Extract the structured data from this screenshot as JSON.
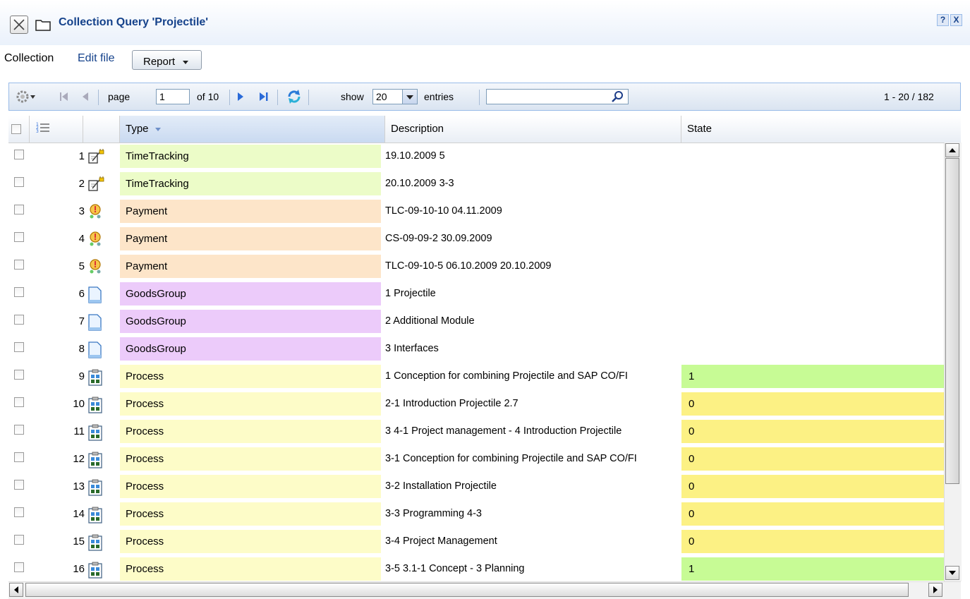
{
  "window": {
    "title": "Collection Query 'Projectile'",
    "help_label": "?",
    "close_label": "X"
  },
  "top": {
    "collection_label": "Collection",
    "edit_file_label": "Edit file",
    "report_label": "Report"
  },
  "toolbar": {
    "page_label": "page",
    "page_value": "1",
    "of_label": "of 10",
    "show_label": "show",
    "show_value": "20",
    "entries_label": "entries",
    "search_value": "",
    "range_label": "1 - 20 / 182"
  },
  "columns": {
    "type": "Type",
    "description": "Description",
    "state": "State"
  },
  "colors": {
    "TimeTracking": "#ecfcc8",
    "Payment": "#fde5c9",
    "GoodsGroup": "#eccbfa",
    "Process": "#fdfcc8",
    "state_1": "#c7fb95",
    "state_0": "#fcf184"
  },
  "rows": [
    {
      "num": "1",
      "icon": "timetracking-icon",
      "type": "TimeTracking",
      "description": "19.10.2009 5",
      "state": ""
    },
    {
      "num": "2",
      "icon": "timetracking-icon",
      "type": "TimeTracking",
      "description": "20.10.2009 3-3",
      "state": ""
    },
    {
      "num": "3",
      "icon": "payment-icon",
      "type": "Payment",
      "description": "TLC-09-10-10 04.11.2009",
      "state": ""
    },
    {
      "num": "4",
      "icon": "payment-icon",
      "type": "Payment",
      "description": "CS-09-09-2 30.09.2009",
      "state": ""
    },
    {
      "num": "5",
      "icon": "payment-icon",
      "type": "Payment",
      "description": "TLC-09-10-5 06.10.2009 20.10.2009",
      "state": ""
    },
    {
      "num": "6",
      "icon": "document-icon",
      "type": "GoodsGroup",
      "description": "1 Projectile",
      "state": ""
    },
    {
      "num": "7",
      "icon": "document-icon",
      "type": "GoodsGroup",
      "description": "2 Additional Module",
      "state": ""
    },
    {
      "num": "8",
      "icon": "document-icon",
      "type": "GoodsGroup",
      "description": "3 Interfaces",
      "state": ""
    },
    {
      "num": "9",
      "icon": "process-icon",
      "type": "Process",
      "description": "1 Conception for combining Projectile and SAP CO/FI",
      "state": "1"
    },
    {
      "num": "10",
      "icon": "process-icon",
      "type": "Process",
      "description": "2-1 Introduction Projectile 2.7",
      "state": "0"
    },
    {
      "num": "11",
      "icon": "process-icon",
      "type": "Process",
      "description": "3 4-1 Project management - 4 Introduction Projectile",
      "state": "0"
    },
    {
      "num": "12",
      "icon": "process-icon",
      "type": "Process",
      "description": "3-1 Conception for combining Projectile and SAP CO/FI",
      "state": "0"
    },
    {
      "num": "13",
      "icon": "process-icon",
      "type": "Process",
      "description": "3-2 Installation Projectile",
      "state": "0"
    },
    {
      "num": "14",
      "icon": "process-icon",
      "type": "Process",
      "description": "3-3 Programming 4-3",
      "state": "0"
    },
    {
      "num": "15",
      "icon": "process-icon",
      "type": "Process",
      "description": "3-4 Project Management",
      "state": "0"
    },
    {
      "num": "16",
      "icon": "process-icon",
      "type": "Process",
      "description": "3-5 3.1-1 Concept - 3 Planning",
      "state": "1"
    }
  ]
}
